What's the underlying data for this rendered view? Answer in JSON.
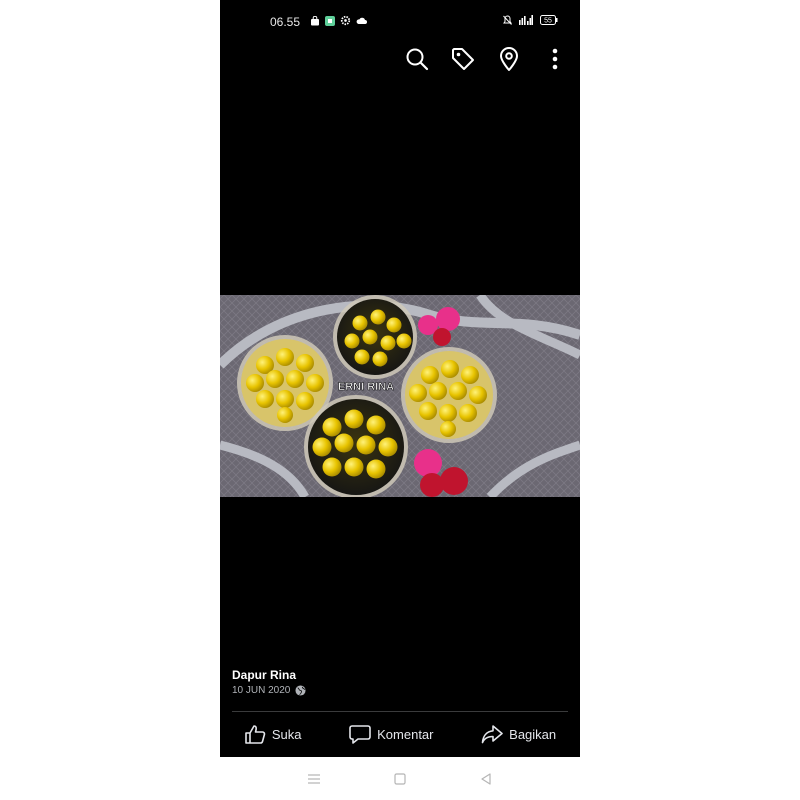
{
  "status_bar": {
    "time": "06.55",
    "battery": "55"
  },
  "top_actions": {
    "icons": [
      "search-icon",
      "tag-icon",
      "location-pin-icon",
      "more-vertical-icon"
    ]
  },
  "photo": {
    "watermark": "ERNI RINA"
  },
  "post": {
    "author": "Dapur Rina",
    "date": "10 JUN 2020",
    "privacy_icon": "globe-icon"
  },
  "actions": {
    "like": "Suka",
    "comment": "Komentar",
    "share": "Bagikan"
  },
  "nav": {
    "icons": [
      "menu-icon",
      "home-icon",
      "back-icon"
    ]
  },
  "colors": {
    "background": "#000000",
    "text": "#e4e6eb",
    "secondary_text": "#b0b3b8"
  }
}
